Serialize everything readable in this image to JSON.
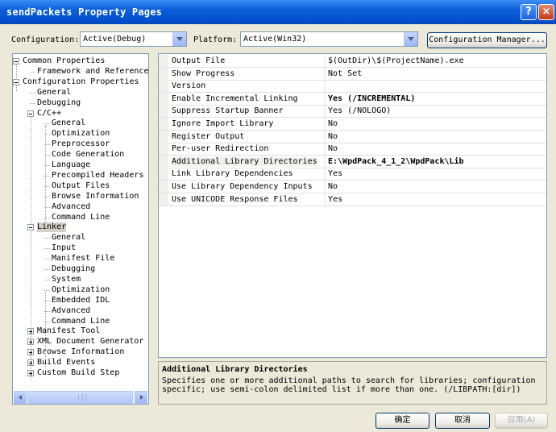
{
  "window": {
    "title": "sendPackets Property Pages",
    "help_glyph": "?",
    "close_glyph": "×"
  },
  "toolbar": {
    "configuration_label": "Configuration:",
    "configuration_value": "Active(Debug)",
    "platform_label": "Platform:",
    "platform_value": "Active(Win32)",
    "config_manager_label": "Configuration Manager..."
  },
  "tree": {
    "items": [
      {
        "label": "Common Properties",
        "expander": "minus"
      },
      {
        "label": "Framework and References",
        "expander": ""
      },
      {
        "label": "Configuration Properties",
        "expander": "minus"
      },
      {
        "label": "General",
        "expander": ""
      },
      {
        "label": "Debugging",
        "expander": ""
      },
      {
        "label": "C/C++",
        "expander": "minus"
      },
      {
        "label": "General",
        "expander": ""
      },
      {
        "label": "Optimization",
        "expander": ""
      },
      {
        "label": "Preprocessor",
        "expander": ""
      },
      {
        "label": "Code Generation",
        "expander": ""
      },
      {
        "label": "Language",
        "expander": ""
      },
      {
        "label": "Precompiled Headers",
        "expander": ""
      },
      {
        "label": "Output Files",
        "expander": ""
      },
      {
        "label": "Browse Information",
        "expander": ""
      },
      {
        "label": "Advanced",
        "expander": ""
      },
      {
        "label": "Command Line",
        "expander": ""
      },
      {
        "label": "Linker",
        "expander": "minus",
        "selected": true
      },
      {
        "label": "General",
        "expander": ""
      },
      {
        "label": "Input",
        "expander": ""
      },
      {
        "label": "Manifest File",
        "expander": ""
      },
      {
        "label": "Debugging",
        "expander": ""
      },
      {
        "label": "System",
        "expander": ""
      },
      {
        "label": "Optimization",
        "expander": ""
      },
      {
        "label": "Embedded IDL",
        "expander": ""
      },
      {
        "label": "Advanced",
        "expander": ""
      },
      {
        "label": "Command Line",
        "expander": ""
      },
      {
        "label": "Manifest Tool",
        "expander": "plus"
      },
      {
        "label": "XML Document Generator",
        "expander": "plus"
      },
      {
        "label": "Browse Information",
        "expander": "plus"
      },
      {
        "label": "Build Events",
        "expander": "plus"
      },
      {
        "label": "Custom Build Step",
        "expander": "plus"
      }
    ]
  },
  "properties": {
    "rows": [
      {
        "name": "Output File",
        "value": "$(OutDir)\\$(ProjectName).exe",
        "bold": false
      },
      {
        "name": "Show Progress",
        "value": "Not Set",
        "bold": false
      },
      {
        "name": "Version",
        "value": "",
        "bold": false
      },
      {
        "name": "Enable Incremental Linking",
        "value": "Yes (/INCREMENTAL)",
        "bold": true
      },
      {
        "name": "Suppress Startup Banner",
        "value": "Yes (/NOLOGO)",
        "bold": false
      },
      {
        "name": "Ignore Import Library",
        "value": "No",
        "bold": false
      },
      {
        "name": "Register Output",
        "value": "No",
        "bold": false
      },
      {
        "name": "Per-user Redirection",
        "value": "No",
        "bold": false
      },
      {
        "name": "Additional Library Directories",
        "value": "E:\\WpdPack_4_1_2\\WpdPack\\Lib",
        "bold": true,
        "selected": true
      },
      {
        "name": "Link Library Dependencies",
        "value": "Yes",
        "bold": false
      },
      {
        "name": "Use Library Dependency Inputs",
        "value": "No",
        "bold": false
      },
      {
        "name": "Use UNICODE Response Files",
        "value": "Yes",
        "bold": false
      }
    ]
  },
  "description": {
    "title": "Additional Library Directories",
    "body": "Specifies one or more additional paths to search for libraries; configuration specific; use semi-colon delimited list if more than one.      (/LIBPATH:[dir])"
  },
  "footer": {
    "ok_label": "确定",
    "cancel_label": "取消",
    "apply_label": "应用(A)"
  },
  "scrollbar": {
    "grip": "|||"
  }
}
